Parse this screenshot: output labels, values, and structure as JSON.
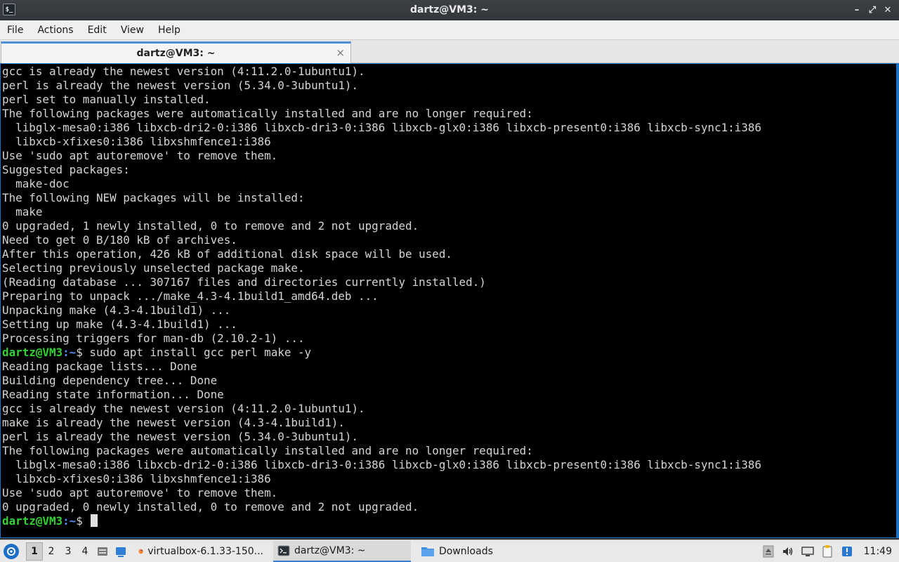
{
  "window": {
    "title": "dartz@VM3: ~",
    "icon_glyph": "$_",
    "controls": {
      "minimize": "–",
      "maximize": "⤢",
      "close": "✕"
    }
  },
  "menu": [
    "File",
    "Actions",
    "Edit",
    "View",
    "Help"
  ],
  "tab": {
    "label": "dartz@VM3: ~",
    "close": "×"
  },
  "terminal": {
    "colors": {
      "background": "#000000",
      "text": "#d4d4d4",
      "user": "#33d133",
      "path": "#4f8ff5"
    },
    "lines": [
      {
        "text": "gcc is already the newest version (4:11.2.0-1ubuntu1)."
      },
      {
        "text": "perl is already the newest version (5.34.0-3ubuntu1)."
      },
      {
        "text": "perl set to manually installed."
      },
      {
        "text": "The following packages were automatically installed and are no longer required:"
      },
      {
        "text": "  libglx-mesa0:i386 libxcb-dri2-0:i386 libxcb-dri3-0:i386 libxcb-glx0:i386 libxcb-present0:i386 libxcb-sync1:i386"
      },
      {
        "text": "  libxcb-xfixes0:i386 libxshmfence1:i386"
      },
      {
        "text": "Use 'sudo apt autoremove' to remove them."
      },
      {
        "text": "Suggested packages:"
      },
      {
        "text": "  make-doc"
      },
      {
        "text": "The following NEW packages will be installed:"
      },
      {
        "text": "  make"
      },
      {
        "text": "0 upgraded, 1 newly installed, 0 to remove and 2 not upgraded."
      },
      {
        "text": "Need to get 0 B/180 kB of archives."
      },
      {
        "text": "After this operation, 426 kB of additional disk space will be used."
      },
      {
        "text": "Selecting previously unselected package make."
      },
      {
        "text": "(Reading database ... 307167 files and directories currently installed.)"
      },
      {
        "text": "Preparing to unpack .../make_4.3-4.1build1_amd64.deb ..."
      },
      {
        "text": "Unpacking make (4.3-4.1build1) ..."
      },
      {
        "text": "Setting up make (4.3-4.1build1) ..."
      },
      {
        "text": "Processing triggers for man-db (2.10.2-1) ..."
      },
      {
        "prompt": true,
        "user": "dartz@VM3",
        "path": ":~",
        "symbol": "$ ",
        "command": "sudo apt install gcc perl make -y"
      },
      {
        "text": "Reading package lists... Done"
      },
      {
        "text": "Building dependency tree... Done"
      },
      {
        "text": "Reading state information... Done"
      },
      {
        "text": "gcc is already the newest version (4:11.2.0-1ubuntu1)."
      },
      {
        "text": "make is already the newest version (4.3-4.1build1)."
      },
      {
        "text": "perl is already the newest version (5.34.0-3ubuntu1)."
      },
      {
        "text": "The following packages were automatically installed and are no longer required:"
      },
      {
        "text": "  libglx-mesa0:i386 libxcb-dri2-0:i386 libxcb-dri3-0:i386 libxcb-glx0:i386 libxcb-present0:i386 libxcb-sync1:i386"
      },
      {
        "text": "  libxcb-xfixes0:i386 libxshmfence1:i386"
      },
      {
        "text": "Use 'sudo apt autoremove' to remove them."
      },
      {
        "text": "0 upgraded, 0 newly installed, 0 to remove and 2 not upgraded."
      },
      {
        "prompt": true,
        "user": "dartz@VM3",
        "path": ":~",
        "symbol": "$ ",
        "command": "",
        "cursor": true
      }
    ]
  },
  "taskbar": {
    "workspaces": [
      "1",
      "2",
      "3",
      "4"
    ],
    "active_workspace": "1",
    "tasks": [
      {
        "label": "virtualbox-6.1.33-150...",
        "icon": "firefox-icon"
      },
      {
        "label": "dartz@VM3: ~",
        "icon": "terminal-icon",
        "active": true
      },
      {
        "label": "Downloads",
        "icon": "folder-icon"
      }
    ],
    "clock": "11:49"
  }
}
